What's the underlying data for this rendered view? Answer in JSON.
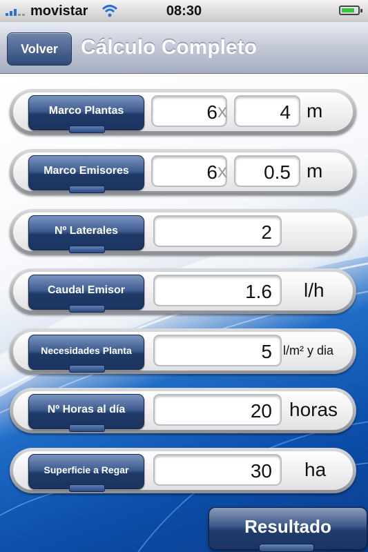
{
  "status_bar": {
    "carrier": "movistar",
    "time": "08:30"
  },
  "nav": {
    "back_label": "Volver",
    "title": "Cálculo Completo"
  },
  "rows": [
    {
      "label": "Marco Plantas",
      "value1": "6",
      "separator": "x",
      "value2": "4",
      "unit": "m"
    },
    {
      "label": "Marco Emisores",
      "value1": "6",
      "separator": "x",
      "value2": "0.5",
      "unit": "m"
    },
    {
      "label": "Nº Laterales",
      "value": "2",
      "unit": ""
    },
    {
      "label": "Caudal Emisor",
      "value": "1.6",
      "unit": "l/h"
    },
    {
      "label": "Necesidades Planta",
      "value": "5",
      "unit": "l/m² y dia"
    },
    {
      "label": "Nº Horas al día",
      "value": "20",
      "unit": "horas"
    },
    {
      "label": "Superficie a Regar",
      "value": "30",
      "unit": "ha"
    }
  ],
  "result_button": {
    "label": "Resultado"
  },
  "icons": [
    "signal-icon",
    "wifi-icon",
    "battery-icon"
  ],
  "colors": {
    "button_blue": "#2f4a7a",
    "background_blue": "#0b4da8"
  }
}
